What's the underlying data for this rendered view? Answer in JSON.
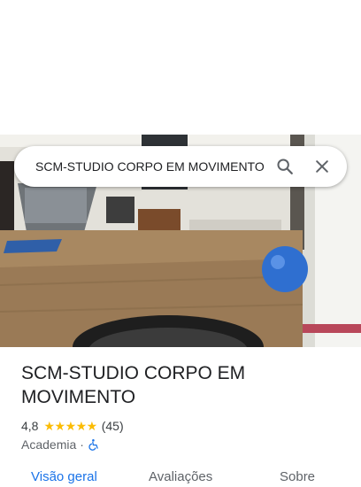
{
  "search": {
    "value": "SCM-STUDIO CORPO EM MOVIMENTO",
    "search_icon": "search-icon",
    "close_icon": "close-icon"
  },
  "place": {
    "name": "SCM-STUDIO CORPO EM MOVIMENTO",
    "rating": "4,8",
    "stars": "★★★★★",
    "review_count": "(45)",
    "category": "Academia",
    "separator": "·",
    "accessibility_icon": "wheelchair-icon"
  },
  "tabs": [
    {
      "label": "Visão geral",
      "active": true
    },
    {
      "label": "Avaliações",
      "active": false
    },
    {
      "label": "Sobre",
      "active": false
    }
  ],
  "colors": {
    "accent": "#1a73e8",
    "star": "#fbbc04"
  }
}
